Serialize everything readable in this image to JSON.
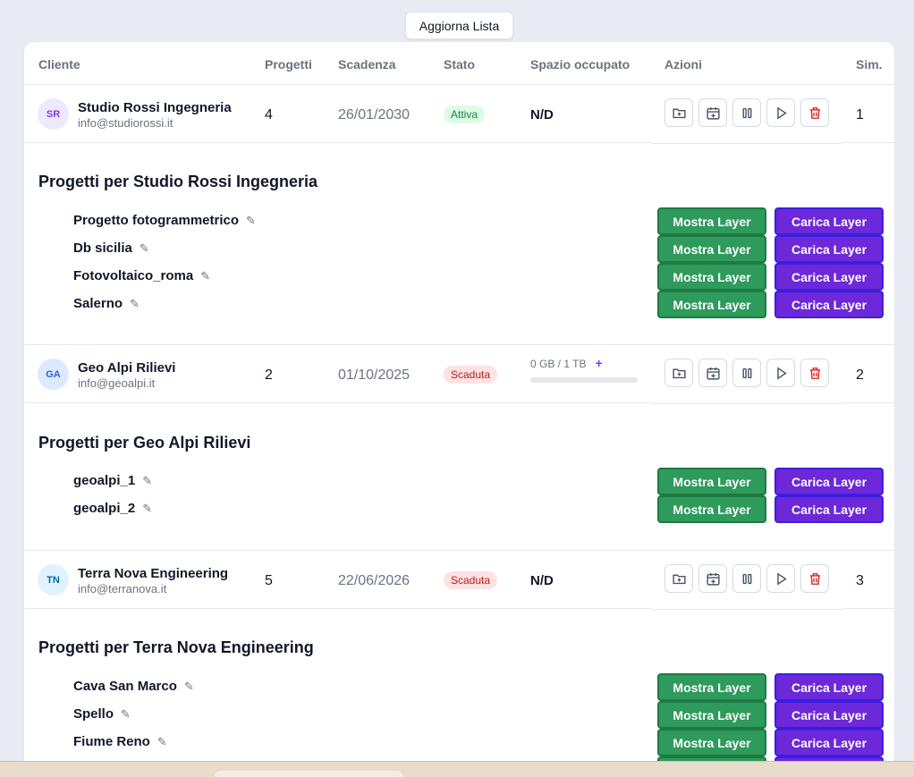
{
  "toolbar": {
    "refresh_label": "Aggiorna Lista"
  },
  "table": {
    "headers": {
      "client": "Cliente",
      "projects": "Progetti",
      "due": "Scadenza",
      "status": "Stato",
      "space": "Spazio occupato",
      "actions": "Azioni",
      "sim": "Sim."
    },
    "colors": {
      "active_bg": "#dcfce7",
      "expired_bg": "#fee2e2",
      "show_btn": "#2e9a5b",
      "load_btn": "#6d28d9"
    }
  },
  "clients": [
    {
      "initials": "SR",
      "name": "Studio Rossi Ingegneria",
      "email": "info@studiorossi.it",
      "projects_count": "4",
      "due": "26/01/2030",
      "status": "Attiva",
      "space": "N/D",
      "sim": "1",
      "section_title": "Progetti per Studio Rossi Ingegneria",
      "projects": [
        "Progetto fotogrammetrico",
        "Db sicilia",
        "Fotovoltaico_roma",
        "Salerno"
      ]
    },
    {
      "initials": "GA",
      "name": "Geo Alpi Rilievi",
      "email": "info@geoalpi.it",
      "projects_count": "2",
      "due": "01/10/2025",
      "status": "Scaduta",
      "space_text": "0 GB / 1 TB",
      "space_plus": "+",
      "space_used_fraction": 0,
      "sim": "2",
      "section_title": "Progetti per Geo Alpi Rilievi",
      "projects": [
        "geoalpi_1",
        "geoalpi_2"
      ]
    },
    {
      "initials": "TN",
      "name": "Terra Nova Engineering",
      "email": "info@terranova.it",
      "projects_count": "5",
      "due": "22/06/2026",
      "status": "Scaduta",
      "space": "N/D",
      "sim": "3",
      "section_title": "Progetti per Terra Nova Engineering",
      "projects": [
        "Cava San Marco",
        "Spello",
        "Fiume Reno"
      ]
    }
  ],
  "project_buttons": {
    "show": "Mostra Layer",
    "load": "Carica Layer"
  },
  "icons": {
    "edit": "pencil-icon",
    "actions": [
      "folder-plus-icon",
      "calendar-plus-icon",
      "pause-icon",
      "play-icon",
      "trash-icon"
    ]
  }
}
